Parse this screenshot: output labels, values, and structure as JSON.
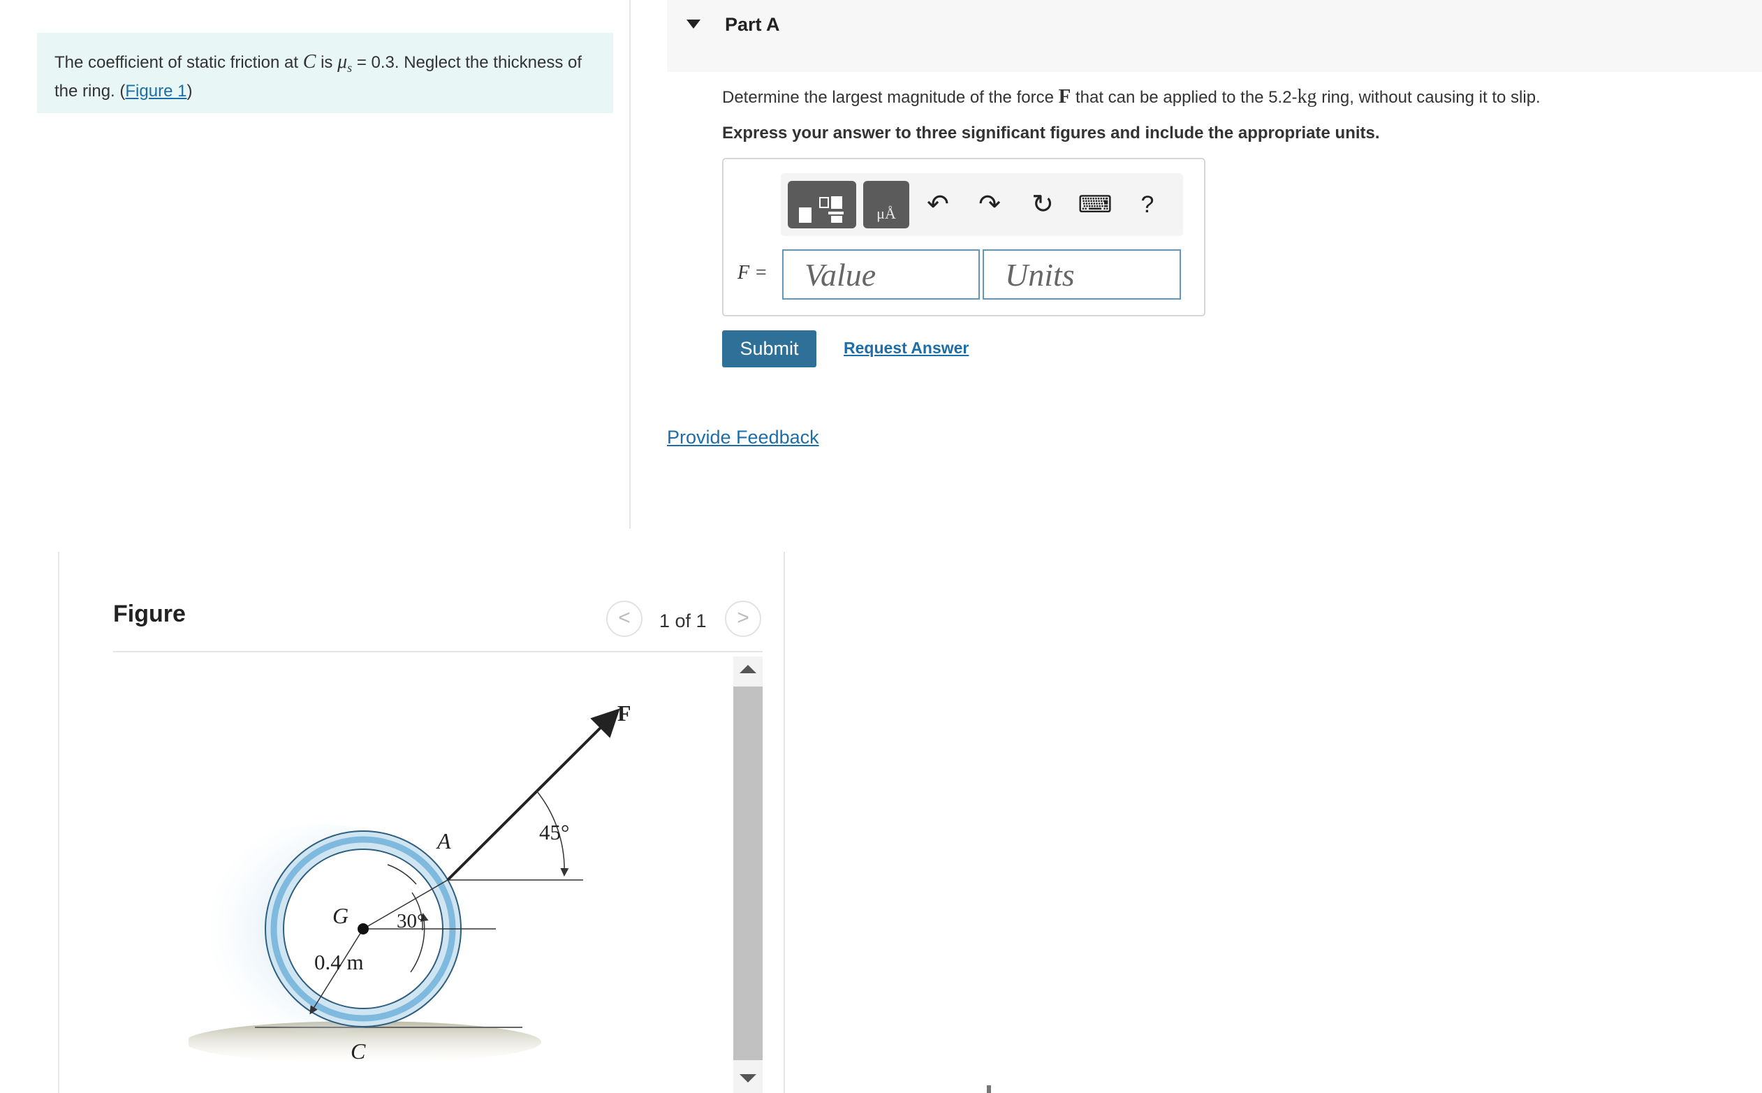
{
  "problem": {
    "text_before": "The coefficient of static friction at ",
    "point": "C",
    "text_is": " is ",
    "mu": "μ",
    "mu_sub": "s",
    "text_after": " = 0.3. Neglect the thickness of the ring. (",
    "figure_link": "Figure 1",
    "close_paren": ")"
  },
  "part": {
    "title": "Part A"
  },
  "question": {
    "before": "Determine the largest magnitude of the force ",
    "force": "F",
    "middle": " that can be applied to the 5.2-",
    "unit": "kg",
    "after": " ring, without causing it to slip.",
    "instruction": "Express your answer to three significant figures and include the appropriate units."
  },
  "answer": {
    "label": "F =",
    "value_placeholder": "Value",
    "units_placeholder": "Units"
  },
  "toolbar": {
    "units_icon_text": "μÅ",
    "undo": "↶",
    "redo": "↷",
    "reset": "↻",
    "keyboard": "⌨",
    "help": "?"
  },
  "buttons": {
    "submit": "Submit",
    "request_answer": "Request Answer",
    "feedback": "Provide Feedback"
  },
  "figure": {
    "title": "Figure",
    "counter": "1 of 1",
    "prev": "<",
    "next": ">",
    "labels": {
      "force": "F",
      "angle_force": "45°",
      "point_a": "A",
      "point_g": "G",
      "angle_g": "30°",
      "radius": "0.4 m",
      "point_c": "C"
    }
  },
  "colors": {
    "accent": "#2e7097",
    "link": "#1d6ea8",
    "problem_bg": "#e9f6f6",
    "ring": "#7fb9dd"
  }
}
